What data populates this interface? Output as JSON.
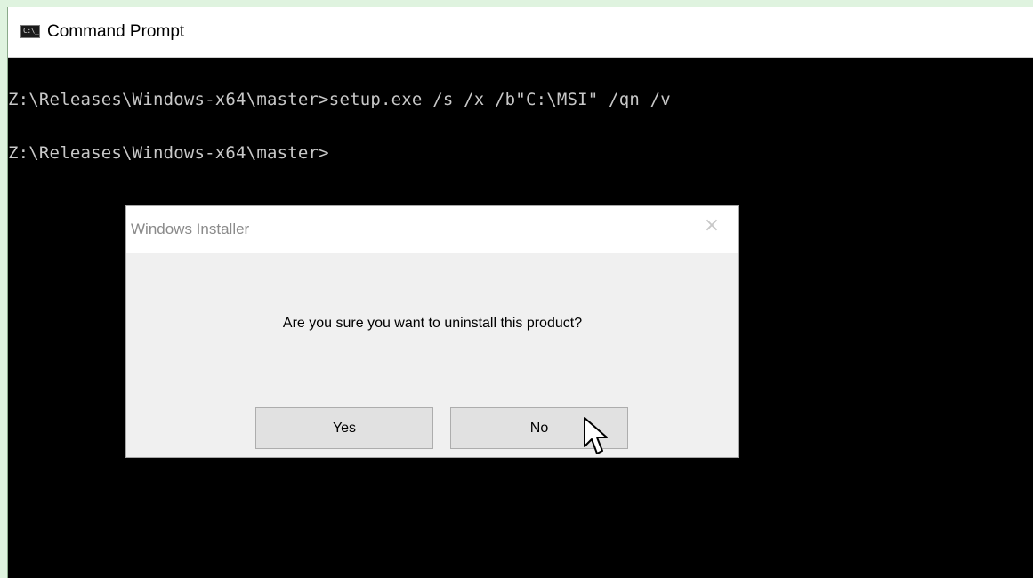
{
  "window": {
    "title": "Command Prompt",
    "icon": "command-prompt-icon",
    "icon_glyph": "C:\\_"
  },
  "console": {
    "lines": [
      "Z:\\Releases\\Windows-x64\\master>setup.exe /s /x /b\"C:\\MSI\" /qn /v",
      "Z:\\Releases\\Windows-x64\\master>"
    ],
    "text_color": "#c8c8c8",
    "background": "#000000"
  },
  "dialog": {
    "title": "Windows Installer",
    "close_glyph": "×",
    "message": "Are you sure you want to uninstall this product?",
    "buttons": {
      "yes_label": "Yes",
      "no_label": "No"
    }
  },
  "cursor": {
    "icon": "mouse-pointer-icon",
    "hover_target": "no-button"
  }
}
